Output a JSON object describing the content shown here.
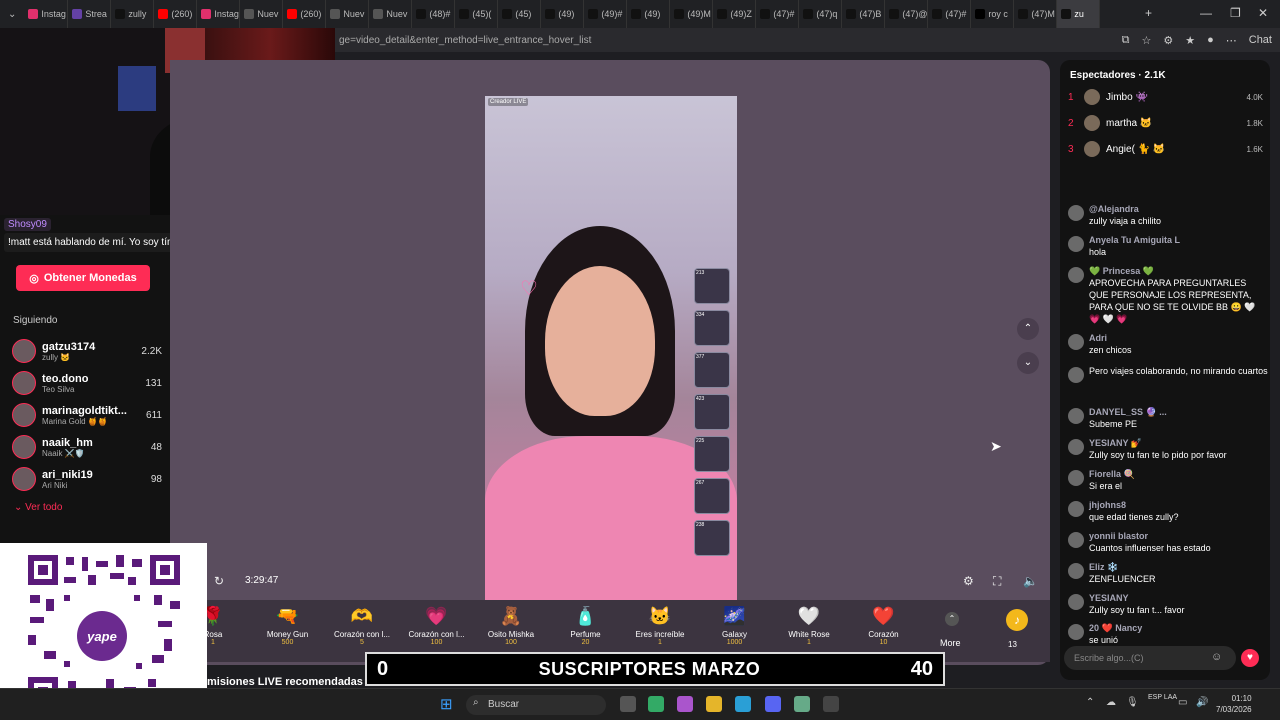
{
  "browser": {
    "tabs": [
      {
        "label": "Instag",
        "color": "#e1306c",
        "active": false
      },
      {
        "label": "Strea",
        "color": "#6441a5",
        "active": false
      },
      {
        "label": "zully",
        "color": "#111111",
        "active": false
      },
      {
        "label": "(260)",
        "color": "#ff0000",
        "active": false
      },
      {
        "label": "Instag",
        "color": "#e1306c",
        "active": false
      },
      {
        "label": "Nuev",
        "color": "#555555",
        "active": false
      },
      {
        "label": "(260)",
        "color": "#ff0000",
        "active": false
      },
      {
        "label": "Nuev",
        "color": "#555555",
        "active": false
      },
      {
        "label": "Nuev",
        "color": "#555555",
        "active": false
      },
      {
        "label": "(48)#",
        "color": "#111111",
        "active": false
      },
      {
        "label": "(45)(",
        "color": "#111111",
        "active": false
      },
      {
        "label": "(45)",
        "color": "#111111",
        "active": false
      },
      {
        "label": "(49)",
        "color": "#111111",
        "active": false
      },
      {
        "label": "(49)#",
        "color": "#111111",
        "active": false
      },
      {
        "label": "(49)",
        "color": "#111111",
        "active": false
      },
      {
        "label": "(49)M",
        "color": "#111111",
        "active": false
      },
      {
        "label": "(49)Z",
        "color": "#111111",
        "active": false
      },
      {
        "label": "(47)#",
        "color": "#111111",
        "active": false
      },
      {
        "label": "(47)q",
        "color": "#111111",
        "active": false
      },
      {
        "label": "(47)B",
        "color": "#111111",
        "active": false
      },
      {
        "label": "(47)@",
        "color": "#111111",
        "active": false
      },
      {
        "label": "(47)#",
        "color": "#111111",
        "active": false
      },
      {
        "label": "roy c",
        "color": "#000000",
        "active": false
      },
      {
        "label": "(47)M",
        "color": "#111111",
        "active": false
      },
      {
        "label": "zu",
        "color": "#111111",
        "active": true
      }
    ],
    "url": "ge=video_detail&enter_method=live_entrance_hover_list",
    "chat_label": "Chat"
  },
  "overlay_chat": {
    "user": "Shosy09",
    "message": "!matt está hablando de mí. Yo soy tímido"
  },
  "sidebar": {
    "coins_button": "Obtener Monedas",
    "following_title": "Siguiendo",
    "following": [
      {
        "name": "gatzu3174",
        "sub": "zully 🐱",
        "count": "2.2K"
      },
      {
        "name": "teo.dono",
        "sub": "Teo Silva",
        "count": "131"
      },
      {
        "name": "marinagoldtikt...",
        "sub": "Marina Gold 🍯🍯",
        "count": "611"
      },
      {
        "name": "naaik_hm",
        "sub": "Naaik ⚔️🛡️",
        "count": "48"
      },
      {
        "name": "ari_niki19",
        "sub": "Ari Niki",
        "count": "98"
      }
    ],
    "see_all": "Ver todo"
  },
  "player": {
    "creator_tag": "Creador LIVE",
    "time": "3:29:47",
    "viewer_stack": [
      "213",
      "334",
      "377",
      "423",
      "225",
      "267",
      "238"
    ]
  },
  "gifts": [
    {
      "name": "Rosa",
      "price": "1",
      "icon": "🌹"
    },
    {
      "name": "Money Gun",
      "price": "500",
      "icon": "🔫"
    },
    {
      "name": "Corazón con l...",
      "price": "5",
      "icon": "🫶"
    },
    {
      "name": "Corazón con l...",
      "price": "100",
      "icon": "💗"
    },
    {
      "name": "Osito Mishka",
      "price": "100",
      "icon": "🧸"
    },
    {
      "name": "Perfume",
      "price": "20",
      "icon": "🧴"
    },
    {
      "name": "Eres increíble",
      "price": "1",
      "icon": "🐱"
    },
    {
      "name": "Galaxy",
      "price": "1000",
      "icon": "🌌"
    },
    {
      "name": "White Rose",
      "price": "1",
      "icon": "🤍"
    },
    {
      "name": "Corazón",
      "price": "10",
      "icon": "❤️"
    }
  ],
  "gift_more": "More",
  "coin_count": "13",
  "recommended": "misiones LIVE recomendadas",
  "subs_banner": {
    "left": "0",
    "title": "SUSCRIPTORES MARZO",
    "right": "40"
  },
  "viewers": {
    "title": "Espectadores · 2.1K",
    "top": [
      {
        "rank": "1",
        "name": "Jimbo 👾",
        "value": "4.0K"
      },
      {
        "rank": "2",
        "name": "martha 🐱",
        "value": "1.8K"
      },
      {
        "rank": "3",
        "name": "Angie( 🐈 🐱",
        "value": "1.6K"
      }
    ]
  },
  "chat": [
    {
      "user": "@Alejandra",
      "text": "zully viaja a chilito"
    },
    {
      "user": "Anyela Tu Amiguita L",
      "text": "hola"
    },
    {
      "user": "💚 Princesa 💚",
      "text": "APROVECHA PARA PREGUNTARLES QUE PERSONAJE LOS REPRESENTA, PARA QUE NO SE TE OLVIDE BB 😀 🤍 💗 🤍 💗"
    },
    {
      "user": "Adri",
      "text": "zen chicos"
    },
    {
      "user": "",
      "text": "Pero viajes colaborando, no mirando cuartos"
    },
    {
      "user": "DANYEL_SS 🔮 ...",
      "text": "Subeme PE"
    },
    {
      "user": "YESIANY 💅",
      "text": "Zully soy tu fan te lo pido por favor"
    },
    {
      "user": "Fiorella 🍭",
      "text": "Si era el"
    },
    {
      "user": "jhjohns8",
      "text": "que edad tienes zully?"
    },
    {
      "user": "yonnii blastor",
      "text": "Cuantos influenser has estado"
    },
    {
      "user": "Eliz ❄️",
      "text": "ZENFLUENCER"
    },
    {
      "user": "YESIANY",
      "text": "Zully soy tu fan t... favor"
    },
    {
      "user": "20 ❤️ Nancy",
      "text": "se unió"
    }
  ],
  "chat_placeholder": "Escribe algo...(C)",
  "taskbar": {
    "search": "Buscar",
    "lang": "ESP LAA",
    "time": "01:10",
    "date": "7/03/2026"
  }
}
